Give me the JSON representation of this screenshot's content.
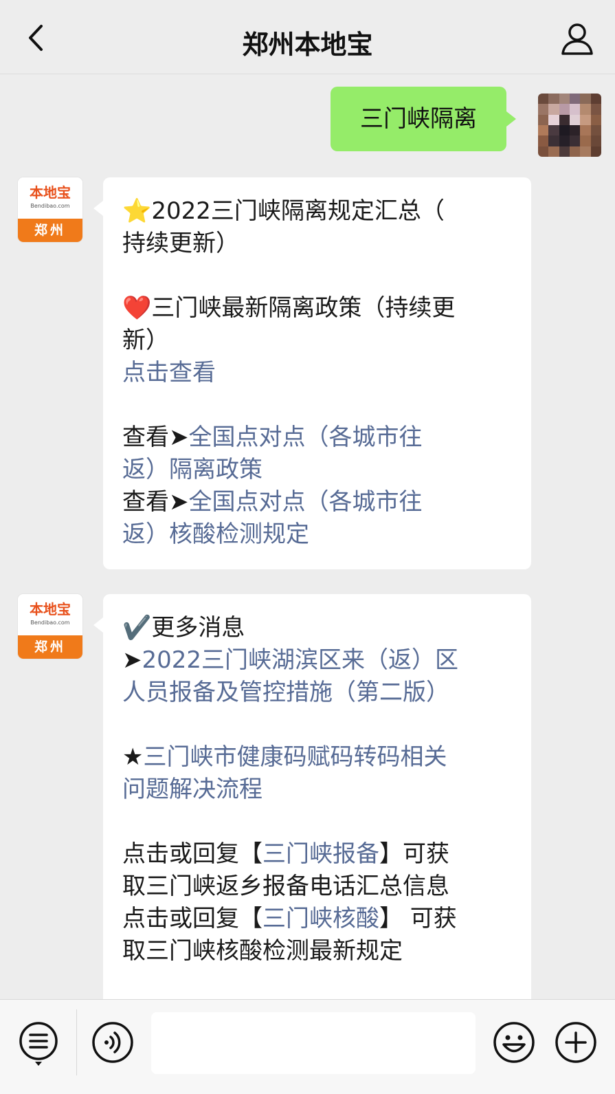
{
  "header": {
    "title": "郑州本地宝"
  },
  "icons": {
    "back": "chevron-left-icon",
    "profile": "person-icon",
    "menu": "menu-list-icon",
    "voice": "voice-icon",
    "emoji": "smiley-icon",
    "plus": "plus-circle-icon"
  },
  "colors": {
    "user_bubble": "#95ec69",
    "link": "#576b95",
    "brand_orange": "#f07a1a"
  },
  "bot": {
    "avatar_logo": "本地宝",
    "avatar_sub": "Bendibao.com",
    "avatar_city": "郑州"
  },
  "messages": {
    "user_query": "三门峡隔离",
    "m1": {
      "l1_emoji": "⭐",
      "l1_text": "2022三门峡隔离规定汇总（",
      "l2": "持续更新）",
      "l3_emoji": "❤️",
      "l3_text": "三门峡最新隔离政策（持续更",
      "l4": "新）",
      "l5_link": "点击查看",
      "l6_prefix": "查看➤",
      "l6_link": "全国点对点（各城市往",
      "l7_link": "返）隔离政策",
      "l8_prefix": "查看➤",
      "l8_link": "全国点对点（各城市往",
      "l9_link": "返）核酸检测规定"
    },
    "m2": {
      "l1_emoji": "✔️",
      "l1_text": "更多消息",
      "l2_prefix": "➤",
      "l2_link": "2022三门峡湖滨区来（返）区",
      "l3_link": "人员报备及管控措施（第二版）",
      "l4_prefix": "★",
      "l4_link": "三门峡市健康码赋码转码相关",
      "l5_link": "问题解决流程",
      "l6_prefix": "点击或回复【",
      "l6_link": "三门峡报备",
      "l6_suffix": "】可获",
      "l7": "取三门峡返乡报备电话汇总信息",
      "l8_prefix": "点击或回复【",
      "l8_link": "三门峡核酸",
      "l8_suffix": "】 可获",
      "l9": "取三门峡核酸检测最新规定"
    }
  },
  "composer": {
    "placeholder": ""
  }
}
